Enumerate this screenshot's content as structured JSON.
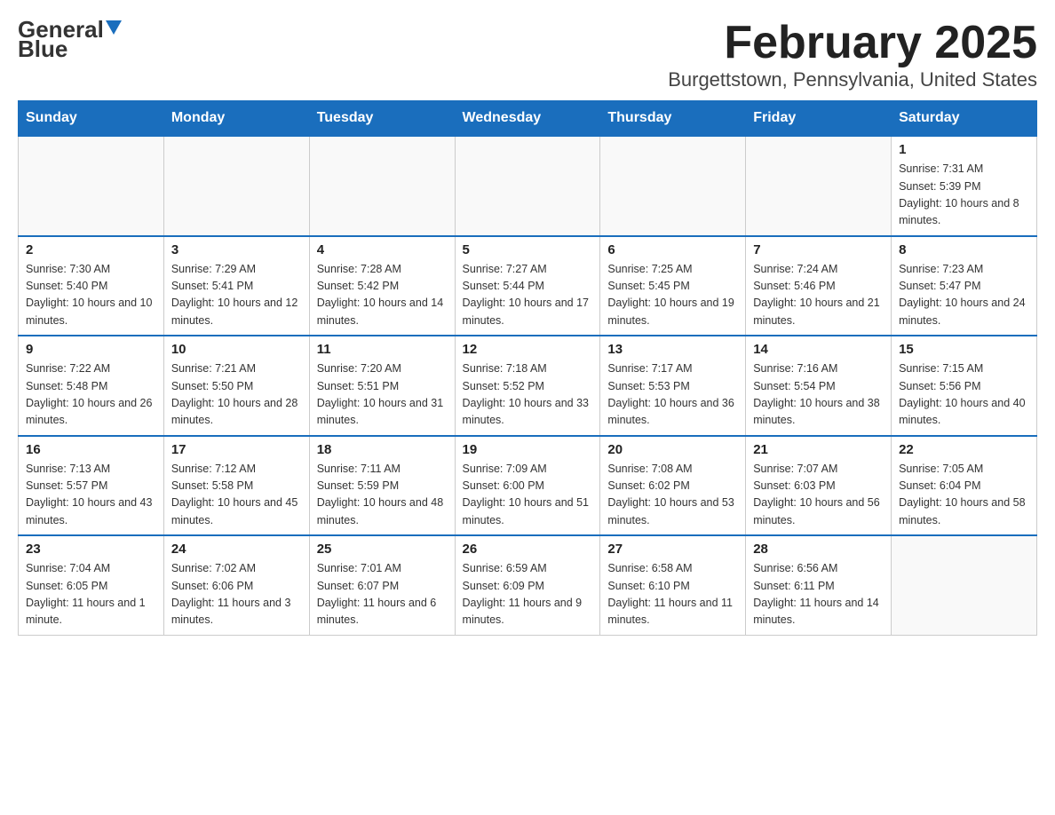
{
  "header": {
    "logo_general": "General",
    "logo_blue": "Blue",
    "month_title": "February 2025",
    "location": "Burgettstown, Pennsylvania, United States"
  },
  "weekdays": [
    "Sunday",
    "Monday",
    "Tuesday",
    "Wednesday",
    "Thursday",
    "Friday",
    "Saturday"
  ],
  "weeks": [
    [
      {
        "day": "",
        "info": ""
      },
      {
        "day": "",
        "info": ""
      },
      {
        "day": "",
        "info": ""
      },
      {
        "day": "",
        "info": ""
      },
      {
        "day": "",
        "info": ""
      },
      {
        "day": "",
        "info": ""
      },
      {
        "day": "1",
        "info": "Sunrise: 7:31 AM\nSunset: 5:39 PM\nDaylight: 10 hours and 8 minutes."
      }
    ],
    [
      {
        "day": "2",
        "info": "Sunrise: 7:30 AM\nSunset: 5:40 PM\nDaylight: 10 hours and 10 minutes."
      },
      {
        "day": "3",
        "info": "Sunrise: 7:29 AM\nSunset: 5:41 PM\nDaylight: 10 hours and 12 minutes."
      },
      {
        "day": "4",
        "info": "Sunrise: 7:28 AM\nSunset: 5:42 PM\nDaylight: 10 hours and 14 minutes."
      },
      {
        "day": "5",
        "info": "Sunrise: 7:27 AM\nSunset: 5:44 PM\nDaylight: 10 hours and 17 minutes."
      },
      {
        "day": "6",
        "info": "Sunrise: 7:25 AM\nSunset: 5:45 PM\nDaylight: 10 hours and 19 minutes."
      },
      {
        "day": "7",
        "info": "Sunrise: 7:24 AM\nSunset: 5:46 PM\nDaylight: 10 hours and 21 minutes."
      },
      {
        "day": "8",
        "info": "Sunrise: 7:23 AM\nSunset: 5:47 PM\nDaylight: 10 hours and 24 minutes."
      }
    ],
    [
      {
        "day": "9",
        "info": "Sunrise: 7:22 AM\nSunset: 5:48 PM\nDaylight: 10 hours and 26 minutes."
      },
      {
        "day": "10",
        "info": "Sunrise: 7:21 AM\nSunset: 5:50 PM\nDaylight: 10 hours and 28 minutes."
      },
      {
        "day": "11",
        "info": "Sunrise: 7:20 AM\nSunset: 5:51 PM\nDaylight: 10 hours and 31 minutes."
      },
      {
        "day": "12",
        "info": "Sunrise: 7:18 AM\nSunset: 5:52 PM\nDaylight: 10 hours and 33 minutes."
      },
      {
        "day": "13",
        "info": "Sunrise: 7:17 AM\nSunset: 5:53 PM\nDaylight: 10 hours and 36 minutes."
      },
      {
        "day": "14",
        "info": "Sunrise: 7:16 AM\nSunset: 5:54 PM\nDaylight: 10 hours and 38 minutes."
      },
      {
        "day": "15",
        "info": "Sunrise: 7:15 AM\nSunset: 5:56 PM\nDaylight: 10 hours and 40 minutes."
      }
    ],
    [
      {
        "day": "16",
        "info": "Sunrise: 7:13 AM\nSunset: 5:57 PM\nDaylight: 10 hours and 43 minutes."
      },
      {
        "day": "17",
        "info": "Sunrise: 7:12 AM\nSunset: 5:58 PM\nDaylight: 10 hours and 45 minutes."
      },
      {
        "day": "18",
        "info": "Sunrise: 7:11 AM\nSunset: 5:59 PM\nDaylight: 10 hours and 48 minutes."
      },
      {
        "day": "19",
        "info": "Sunrise: 7:09 AM\nSunset: 6:00 PM\nDaylight: 10 hours and 51 minutes."
      },
      {
        "day": "20",
        "info": "Sunrise: 7:08 AM\nSunset: 6:02 PM\nDaylight: 10 hours and 53 minutes."
      },
      {
        "day": "21",
        "info": "Sunrise: 7:07 AM\nSunset: 6:03 PM\nDaylight: 10 hours and 56 minutes."
      },
      {
        "day": "22",
        "info": "Sunrise: 7:05 AM\nSunset: 6:04 PM\nDaylight: 10 hours and 58 minutes."
      }
    ],
    [
      {
        "day": "23",
        "info": "Sunrise: 7:04 AM\nSunset: 6:05 PM\nDaylight: 11 hours and 1 minute."
      },
      {
        "day": "24",
        "info": "Sunrise: 7:02 AM\nSunset: 6:06 PM\nDaylight: 11 hours and 3 minutes."
      },
      {
        "day": "25",
        "info": "Sunrise: 7:01 AM\nSunset: 6:07 PM\nDaylight: 11 hours and 6 minutes."
      },
      {
        "day": "26",
        "info": "Sunrise: 6:59 AM\nSunset: 6:09 PM\nDaylight: 11 hours and 9 minutes."
      },
      {
        "day": "27",
        "info": "Sunrise: 6:58 AM\nSunset: 6:10 PM\nDaylight: 11 hours and 11 minutes."
      },
      {
        "day": "28",
        "info": "Sunrise: 6:56 AM\nSunset: 6:11 PM\nDaylight: 11 hours and 14 minutes."
      },
      {
        "day": "",
        "info": ""
      }
    ]
  ]
}
